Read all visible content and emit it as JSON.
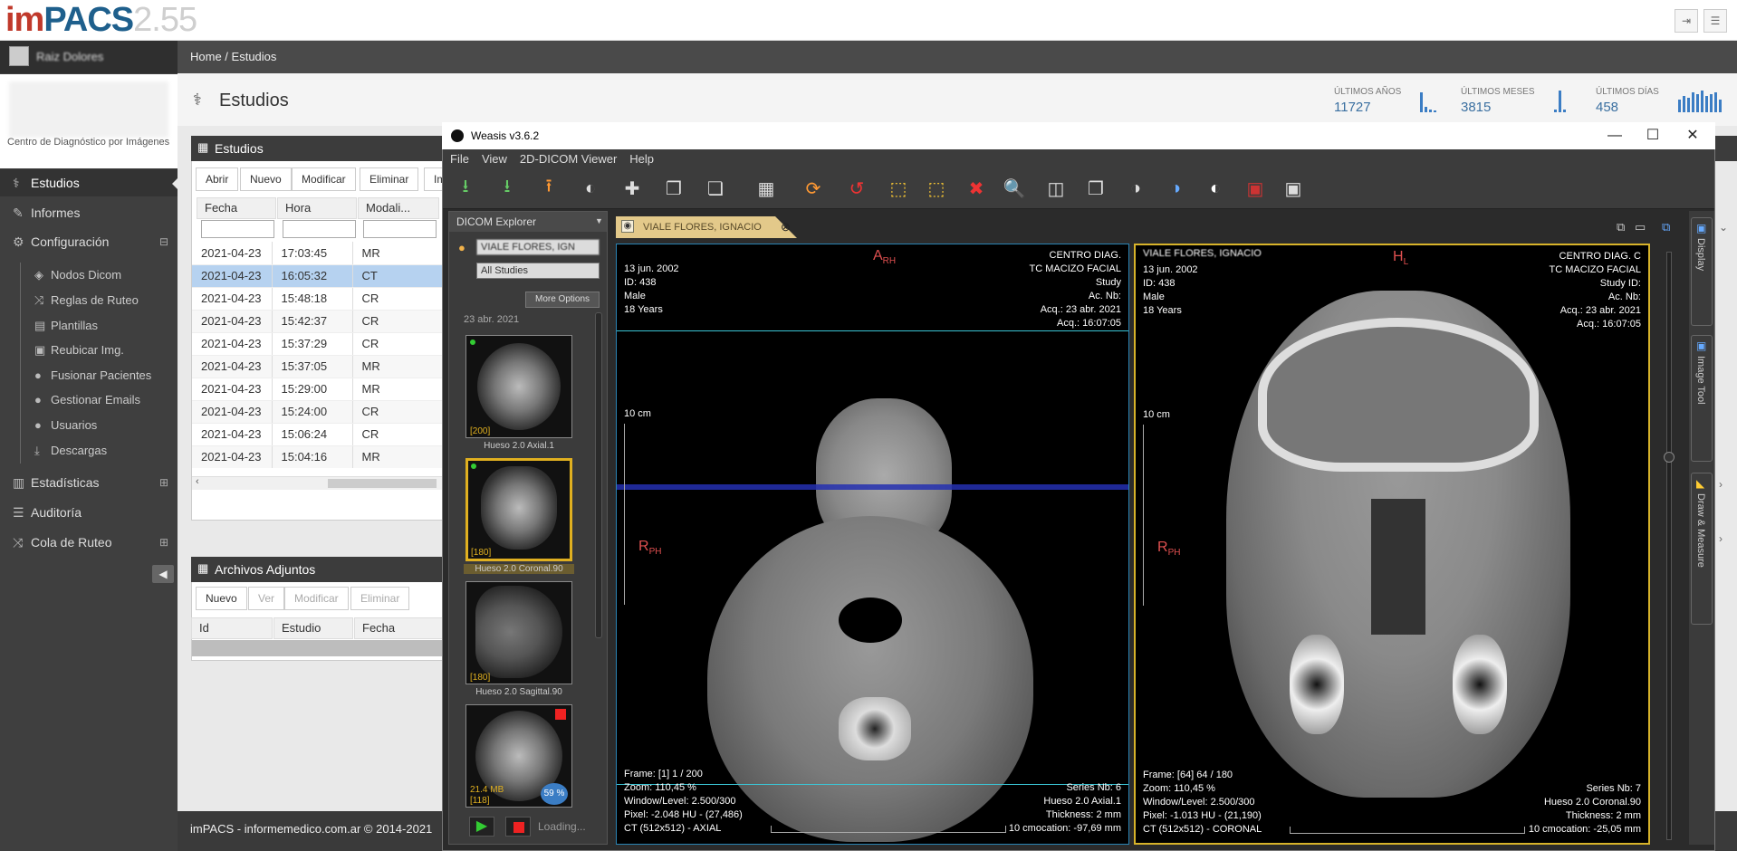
{
  "app": {
    "brand_im": "im",
    "brand_pacs": "PACS",
    "version": "2.55"
  },
  "user": {
    "name": "Raiz Dolores"
  },
  "brand": {
    "caption": "Centro de Diagnóstico por Imágenes"
  },
  "breadcrumb": {
    "home": "Home /",
    "current": "Estudios"
  },
  "page": {
    "title": "Estudios"
  },
  "stats": [
    {
      "label": "ÚLTIMOS AÑOS",
      "value": "11727"
    },
    {
      "label": "ÚLTIMOS MESES",
      "value": "3815"
    },
    {
      "label": "ÚLTIMOS DÍAS",
      "value": "458"
    }
  ],
  "sidebar": {
    "items": [
      {
        "label": "Estudios",
        "icon": "stethoscope-icon"
      },
      {
        "label": "Informes",
        "icon": "edit-icon"
      },
      {
        "label": "Configuración",
        "icon": "gear-icon"
      },
      {
        "label": "Nodos Dicom",
        "icon": "cube-icon"
      },
      {
        "label": "Reglas de Ruteo",
        "icon": "shuffle-icon"
      },
      {
        "label": "Plantillas",
        "icon": "file-icon"
      },
      {
        "label": "Reubicar Img.",
        "icon": "image-icon"
      },
      {
        "label": "Fusionar Pacientes",
        "icon": "user-icon"
      },
      {
        "label": "Gestionar Emails",
        "icon": "user-icon"
      },
      {
        "label": "Usuarios",
        "icon": "user-icon"
      },
      {
        "label": "Descargas",
        "icon": "download-icon"
      },
      {
        "label": "Estadísticas",
        "icon": "bar-chart-icon"
      },
      {
        "label": "Auditoría",
        "icon": "list-icon"
      },
      {
        "label": "Cola de Ruteo",
        "icon": "shuffle-icon"
      }
    ]
  },
  "studies_panel": {
    "title": "Estudios",
    "buttons": [
      "Abrir",
      "Nuevo",
      "Modificar",
      "Eliminar",
      "Im"
    ],
    "columns": [
      "Fecha",
      "Hora",
      "Modali..."
    ],
    "rows": [
      [
        "2021-04-23",
        "17:03:45",
        "MR"
      ],
      [
        "2021-04-23",
        "16:05:32",
        "CT"
      ],
      [
        "2021-04-23",
        "15:48:18",
        "CR"
      ],
      [
        "2021-04-23",
        "15:42:37",
        "CR"
      ],
      [
        "2021-04-23",
        "15:37:29",
        "CR"
      ],
      [
        "2021-04-23",
        "15:37:05",
        "MR"
      ],
      [
        "2021-04-23",
        "15:29:00",
        "MR"
      ],
      [
        "2021-04-23",
        "15:24:00",
        "CR"
      ],
      [
        "2021-04-23",
        "15:06:24",
        "CR"
      ],
      [
        "2021-04-23",
        "15:04:16",
        "MR"
      ]
    ]
  },
  "attachments_panel": {
    "title": "Archivos Adjuntos",
    "buttons": [
      "Nuevo",
      "Ver",
      "Modificar",
      "Eliminar"
    ],
    "columns": [
      "Id",
      "Estudio",
      "Fecha"
    ]
  },
  "footer": {
    "text": "imPACS - informemedico.com.ar © 2014-2021"
  },
  "weasis": {
    "title": "Weasis v3.6.2",
    "menu": [
      "File",
      "View",
      "2D-DICOM Viewer",
      "Help"
    ],
    "explorer": {
      "title": "DICOM Explorer",
      "patient": "VIALE FLORES, IGN",
      "studies_filter": "All Studies",
      "more_options": "More Options",
      "date": "23 abr. 2021",
      "series": [
        {
          "count": "[200]",
          "caption": "Hueso 2.0 Axial.1"
        },
        {
          "count": "[180]",
          "caption": "Hueso 2.0 Coronal.90"
        },
        {
          "count": "[180]",
          "caption": "Hueso 2.0 Sagittal.90"
        },
        {
          "count": "[118]",
          "caption": "21.4 MB",
          "progress": "59 %"
        }
      ],
      "loading": "Loading..."
    },
    "tab": {
      "label": "VIALE FLORES, IGNACIO"
    },
    "side_tabs": [
      "Display",
      "Image Tool",
      "Draw & Measure"
    ],
    "viewers": [
      {
        "dob": "13 jun. 2002",
        "id": "ID: 438",
        "sex": "Male",
        "age": "18 Years",
        "center": "CENTRO DIAG.",
        "study": "TC MACIZO FACIAL",
        "study_label": "Study",
        "acc": "Ac. Nb:",
        "acq_date": "Acq.: 23 abr. 2021",
        "acq_time": "Acq.: 16:07:05",
        "orient_top": "A",
        "orient_top_sub": "RH",
        "orient_left": "R",
        "orient_left_sub": "PH",
        "scale": "10 cm",
        "frame": "Frame: [1] 1 / 200",
        "zoom": "Zoom: 110,45 %",
        "wl": "Window/Level: 2.500/300",
        "pixel": "Pixel: -2.048 HU - (27,486)",
        "dim": "CT (512x512) - AXIAL",
        "series_nb": "Series Nb: 6",
        "series_name": "Hueso 2.0 Axial.1",
        "thickness": "Thickness: 2 mm",
        "location": "10 cmocation: -97,69 mm"
      },
      {
        "name": "VIALE FLORES, IGNACIO",
        "dob": "13 jun. 2002",
        "id": "ID: 438",
        "sex": "Male",
        "age": "18 Years",
        "center": "CENTRO DIAG. C",
        "study": "TC MACIZO FACIAL",
        "study_label": "Study ID:",
        "acc": "Ac. Nb:",
        "acq_date": "Acq.: 23 abr. 2021",
        "acq_time": "Acq.: 16:07:05",
        "orient_top": "H",
        "orient_top_sub": "L",
        "orient_left": "R",
        "orient_left_sub": "PH",
        "scale": "10 cm",
        "frame": "Frame: [64] 64 / 180",
        "zoom": "Zoom: 110,45 %",
        "wl": "Window/Level: 2.500/300",
        "pixel": "Pixel: -1.013 HU - (21,190)",
        "dim": "CT (512x512) - CORONAL",
        "series_nb": "Series Nb: 7",
        "series_name": "Hueso 2.0 Coronal.90",
        "thickness": "Thickness: 2 mm",
        "location": "10 cmocation: -25,05 mm"
      }
    ]
  }
}
